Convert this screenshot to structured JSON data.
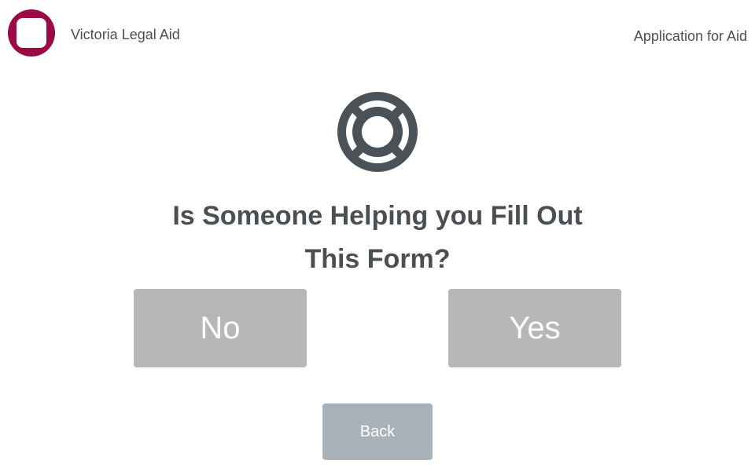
{
  "header": {
    "logo_icon": "rounded-square-logo-icon",
    "org_name": "Victoria Legal Aid",
    "section_title": "Application for Aid"
  },
  "main": {
    "icon": "lifebuoy-icon",
    "question_line1": "Is Someone Helping you Fill Out",
    "question_line2": "This Form?"
  },
  "choices": {
    "no_label": "No",
    "yes_label": "Yes"
  },
  "footer": {
    "back_label": "Back"
  },
  "colors": {
    "brand": "#9a0a45",
    "text": "#4a4f54",
    "choice_button": "#b7b7b7",
    "back_button": "#a9b2b9",
    "icon": "#4a5258"
  }
}
